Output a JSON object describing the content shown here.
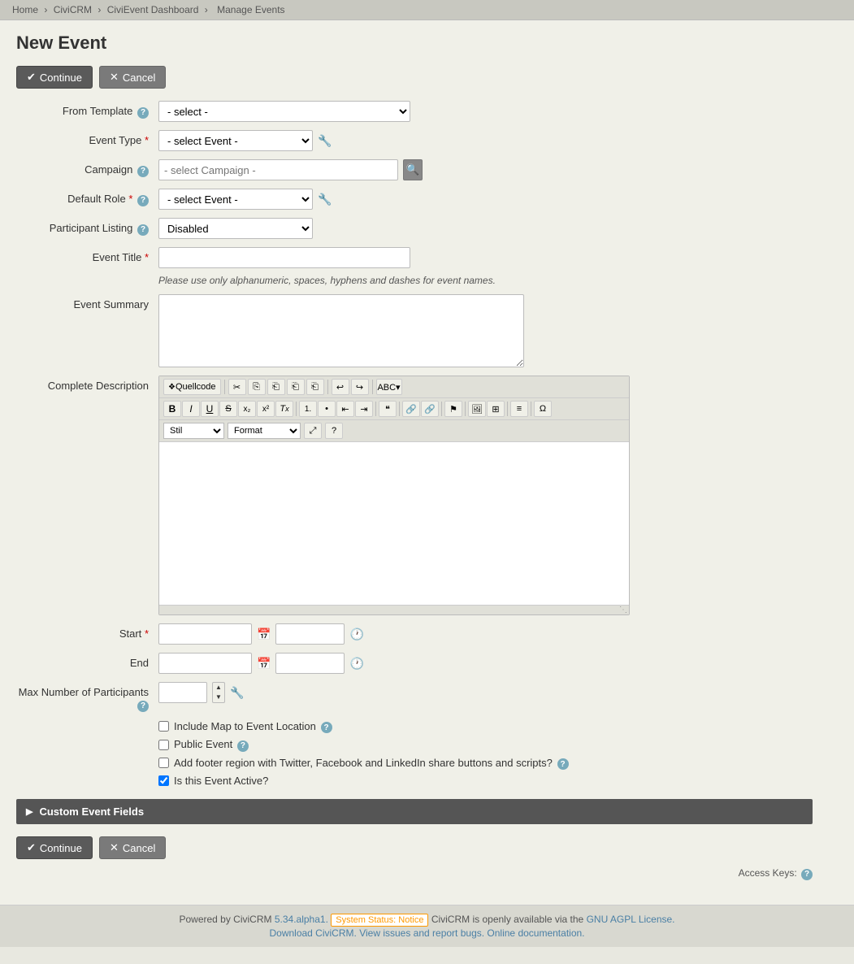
{
  "breadcrumb": {
    "items": [
      "Home",
      "CiviCRM",
      "CiviEvent Dashboard",
      "Manage Events"
    ]
  },
  "page": {
    "title": "New Event"
  },
  "buttons": {
    "continue": "Continue",
    "cancel": "Cancel"
  },
  "form": {
    "from_template": {
      "label": "From Template",
      "placeholder": "- select -",
      "options": [
        "- select -"
      ]
    },
    "event_type": {
      "label": "Event Type",
      "required": true,
      "placeholder": "- select Event -",
      "options": [
        "- select Event -"
      ]
    },
    "campaign": {
      "label": "Campaign",
      "placeholder": "- select Campaign -"
    },
    "default_role": {
      "label": "Default Role",
      "required": true,
      "placeholder": "- select Event -",
      "options": [
        "- select Event -"
      ]
    },
    "participant_listing": {
      "label": "Participant Listing",
      "placeholder": "Disabled",
      "options": [
        "Disabled"
      ]
    },
    "event_title": {
      "label": "Event Title",
      "required": true,
      "hint": "Please use only alphanumeric, spaces, hyphens and dashes for event names."
    },
    "event_summary": {
      "label": "Event Summary"
    },
    "complete_description": {
      "label": "Complete Description",
      "toolbar": {
        "source_btn": "Quellcode",
        "cut": "✂",
        "copy": "⎘",
        "paste": "⎗",
        "paste_plain": "⎗",
        "paste_word": "⎗",
        "undo": "↩",
        "redo": "↪",
        "spell_check": "ABC",
        "bold": "B",
        "italic": "I",
        "underline": "U",
        "strikethrough": "S",
        "subscript": "x₂",
        "superscript": "x²",
        "remove_format": "Tx",
        "ordered_list": "ol",
        "unordered_list": "ul",
        "outdent": "←",
        "indent": "→",
        "blockquote": "❝",
        "link": "🔗",
        "unlink": "🔗",
        "flag": "⚑",
        "image": "🖼",
        "table": "⊞",
        "align": "≡",
        "special_char": "Ω",
        "style_label": "Stil",
        "format_label": "Format",
        "maximize": "⤢",
        "help": "?"
      }
    },
    "start": {
      "label": "Start",
      "required": true,
      "date_placeholder": "",
      "time_placeholder": ""
    },
    "end": {
      "label": "End",
      "date_placeholder": "",
      "time_placeholder": ""
    },
    "max_participants": {
      "label": "Max Number of Participants"
    },
    "checkboxes": {
      "include_map": {
        "label": "Include Map to Event Location",
        "checked": false
      },
      "public_event": {
        "label": "Public Event",
        "checked": false
      },
      "footer_region": {
        "label": "Add footer region with Twitter, Facebook and LinkedIn share buttons and scripts?",
        "checked": false
      },
      "is_active": {
        "label": "Is this Event Active?",
        "checked": true
      }
    }
  },
  "custom_event_fields": {
    "label": "Custom Event Fields"
  },
  "access_keys": {
    "label": "Access Keys:"
  },
  "footer": {
    "powered_by": "Powered by CiviCRM",
    "version": "5.34.alpha1.",
    "system_status": "System Status: Notice",
    "status_text": "CiviCRM is openly available via the",
    "license_link": "GNU AGPL License.",
    "download": "Download CiviCRM.",
    "view_issues": "View issues and report bugs.",
    "online_docs": "Online documentation."
  }
}
